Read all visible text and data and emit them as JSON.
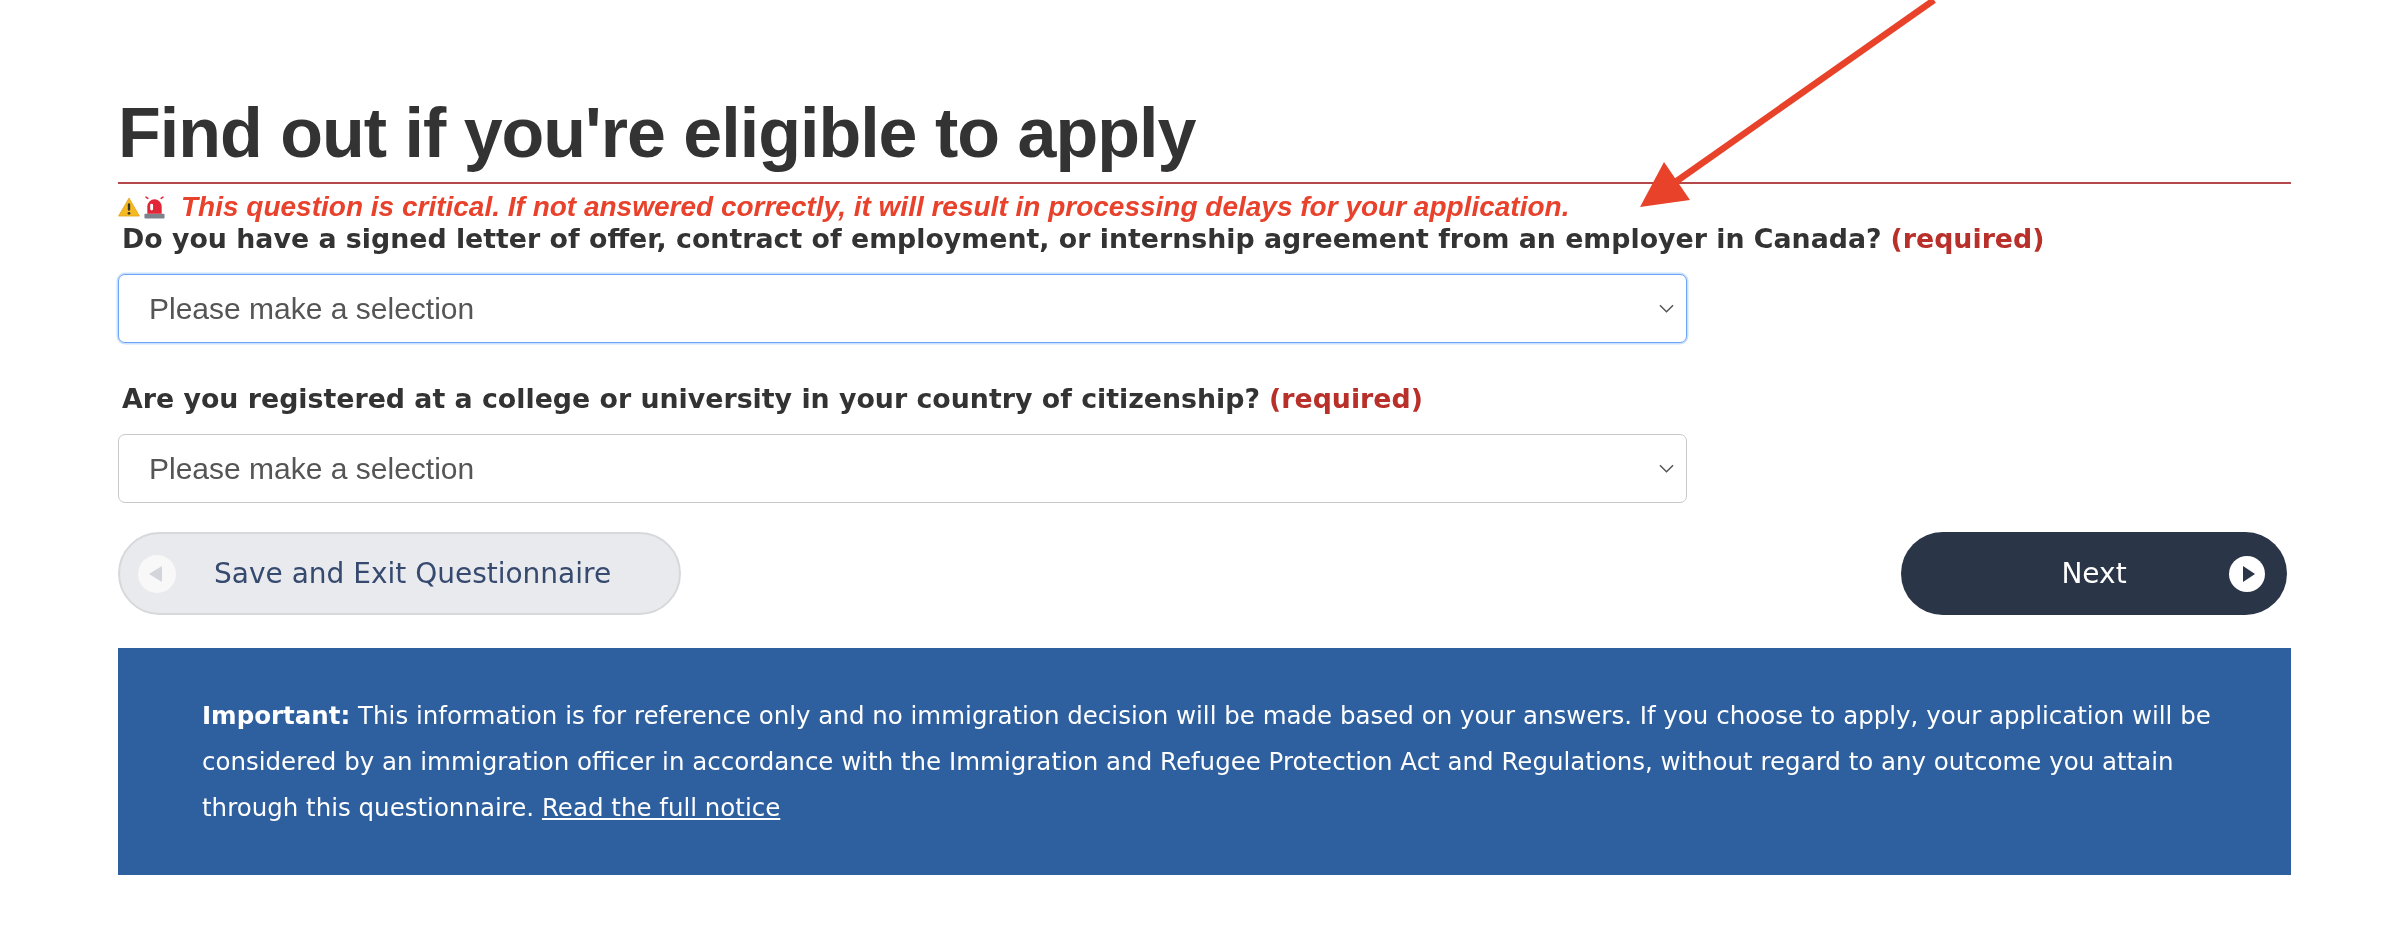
{
  "page": {
    "title": "Find out if you're eligible to apply"
  },
  "warning": {
    "text": "This question is critical. If not answered correctly, it will result in processing delays for your application."
  },
  "questions": [
    {
      "label": "Do you have a signed letter of offer, contract of employment, or internship agreement from an employer in Canada?",
      "required": "(required)",
      "placeholder": "Please make a selection",
      "focused": true
    },
    {
      "label": "Are you registered at a college or university in your country of citizenship?",
      "required": "(required)",
      "placeholder": "Please make a selection",
      "focused": false
    }
  ],
  "buttons": [
    {
      "kind": "back",
      "label": "Save and Exit Questionnaire"
    },
    {
      "kind": "next",
      "label": "Next"
    }
  ],
  "notice": {
    "text": "**Important:** This information is for reference only and no immigration decision will be made based on your answers. If you choose to apply, your application will be considered by an immigration officer in accordance with the Immigration and Refugee Protection Act and Regulations, without regard to any outcome you attain through this questionnaire.",
    "link": "Read the full notice"
  }
}
